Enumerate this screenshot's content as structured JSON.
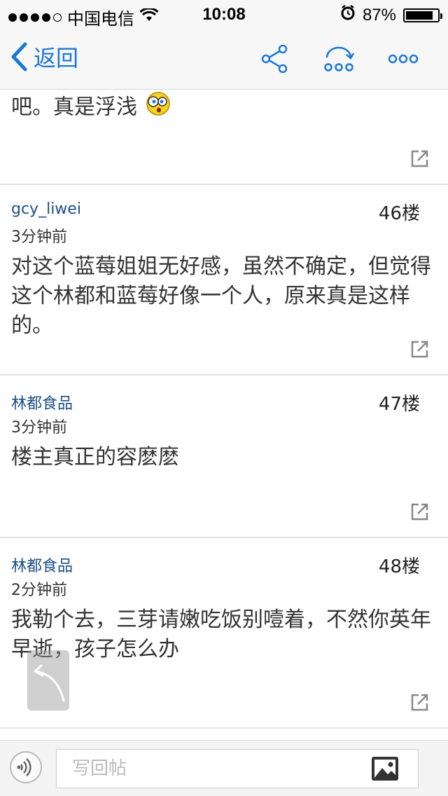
{
  "status_bar": {
    "carrier": "中国电信",
    "time": "10:08",
    "battery_percent": "87%",
    "battery_level": 0.87,
    "signal_bars": 4
  },
  "nav": {
    "back_label": "返回",
    "icons": [
      "share-icon",
      "jump-floor-icon",
      "more-icon"
    ],
    "accent_color": "#1a78d6"
  },
  "posts": [
    {
      "body": "吧。真是浮浅"
    },
    {
      "author": "gcy_liwei",
      "time": "3分钟前",
      "floor": "46楼",
      "body": "对这个蓝莓姐姐无好感，虽然不确定，但觉得这个林都和蓝莓好像一个人，原来真是这样的。"
    },
    {
      "author": "林都食品",
      "time": "3分钟前",
      "floor": "47楼",
      "body": "楼主真正的容麽麽"
    },
    {
      "author": "林都食品",
      "time": "2分钟前",
      "floor": "48楼",
      "body": "我勒个去，三芽请嫩吃饭别噎着，不然你英年早逝，孩子怎么办"
    }
  ],
  "bottom_bar": {
    "reply_placeholder": "写回帖"
  }
}
